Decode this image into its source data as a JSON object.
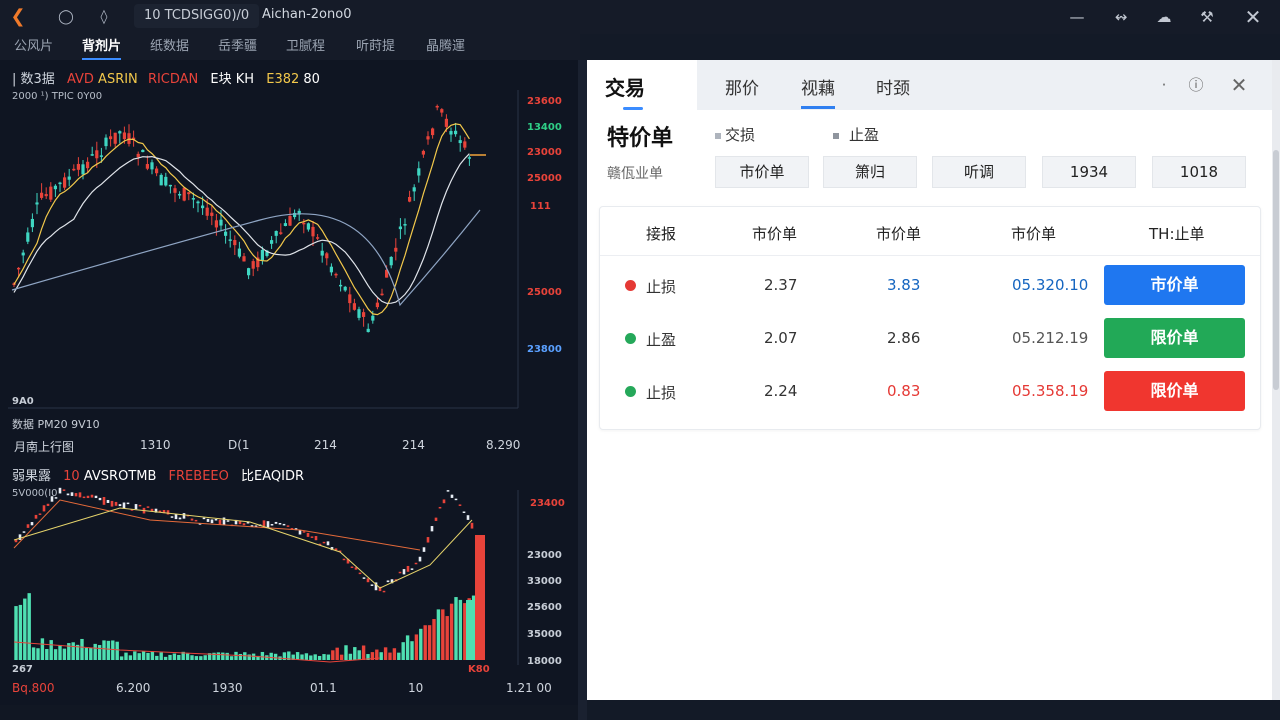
{
  "titlebar": {
    "tab_id": "10   TCDSIGG0)/0",
    "app_title": "Aichan-2ono0",
    "icons": [
      "back-icon",
      "coin-icon",
      "diamond-icon"
    ],
    "window_controls": [
      "minimize-icon",
      "link-icon",
      "cloud-icon",
      "tool-icon",
      "close-icon"
    ]
  },
  "menu": [
    "公风片",
    "背剂片",
    "纸数据",
    "岳季疆",
    "卫腻程",
    "听莳提",
    "晶腾運"
  ],
  "menu_active_index": 1,
  "top_chart": {
    "legend": {
      "prefix": "| 数3据",
      "items": [
        "AVD",
        "ASRIN",
        "RICDAN",
        "E块",
        "KH",
        "E382",
        "80"
      ]
    },
    "subtitle": "2000 ¹)   TPIC 0Y00",
    "y_labels": [
      "23600",
      "13400",
      "23000",
      "25000",
      "111",
      "25000",
      "23800"
    ],
    "bottom_left": "9A0",
    "footer_left": "数据   PM20 9V10",
    "x_labels": [
      "月南上行图",
      "1310",
      "D(1",
      "214",
      "214",
      "8.290"
    ]
  },
  "bottom_chart": {
    "legend": {
      "prefix": "弱果露",
      "items": [
        "10",
        "AVSROTMB",
        "FREBEEO",
        "比EAQIDR"
      ]
    },
    "subtitle": "5V000(I0",
    "y_labels": [
      "23400",
      "23000",
      "33000",
      "25600",
      "35000",
      "18000"
    ],
    "bottom_left": "267",
    "bottom_right": "K80",
    "x_labels": [
      "Bq.800",
      "6.200",
      "1930",
      "01.1",
      "10",
      "1.21 00"
    ]
  },
  "trade": {
    "title": "交易",
    "tabs": [
      "那价",
      "视藕",
      "时颈"
    ],
    "active_tab_index": 1,
    "order_type_label": "特价单",
    "options": [
      "交损",
      "止盈"
    ],
    "field_label": "赣佤业单",
    "segments": [
      "市价单",
      "箫归",
      "听调",
      "1934",
      "1018"
    ],
    "table_headers": [
      "接报",
      "市价单",
      "市价单",
      "市价单",
      "TH:止单"
    ],
    "rows": [
      {
        "status_color": "#e53935",
        "label": "止损",
        "v1": "2.37",
        "v2": "3.83",
        "v2_color": "#1565c0",
        "v3": "05.320.10",
        "v3_color": "#1565c0",
        "action": "市价单",
        "action_color": "#1f77f0"
      },
      {
        "status_color": "#25a85a",
        "label": "止盈",
        "v1": "2.07",
        "v2": "2.86",
        "v2_color": "#333333",
        "v3": "05.212.19",
        "v3_color": "#555555",
        "action": "限价单",
        "action_color": "#22a957"
      },
      {
        "status_color": "#25a85a",
        "label": "止损",
        "v1": "2.24",
        "v2": "0.83",
        "v2_color": "#e53935",
        "v3": "05.358.19",
        "v3_color": "#e53935",
        "action": "限价单",
        "action_color": "#f0362f"
      }
    ]
  },
  "colors": {
    "up": "#3fd6c2",
    "down": "#e8433a",
    "accent": "#3b8cff"
  }
}
